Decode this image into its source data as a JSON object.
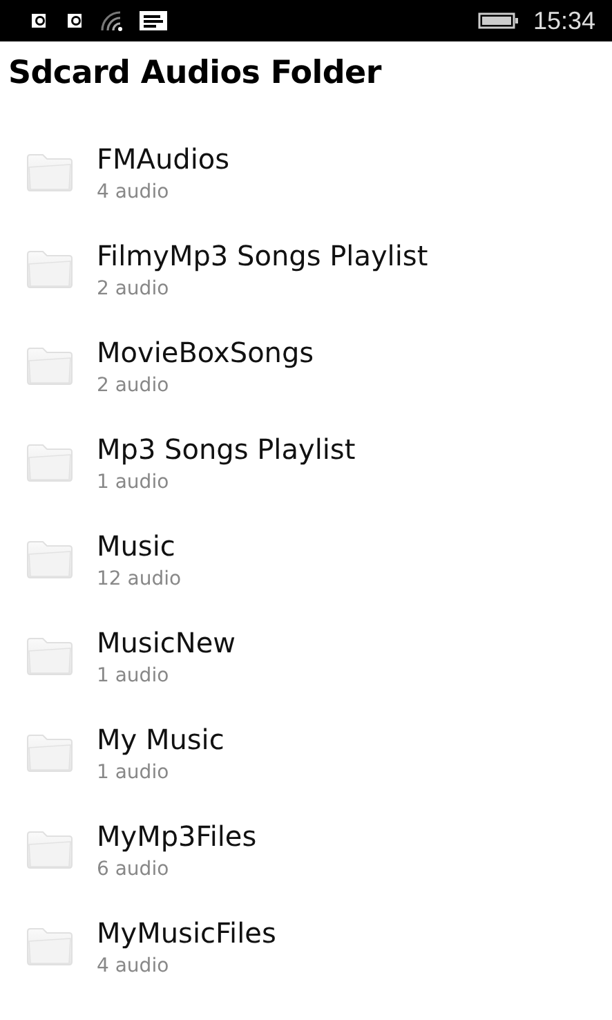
{
  "status_bar": {
    "time": "15:34"
  },
  "title": "Sdcard Audios Folder",
  "folders": [
    {
      "name": "FMAudios",
      "count": "4 audio"
    },
    {
      "name": "FilmyMp3 Songs Playlist",
      "count": "2 audio"
    },
    {
      "name": "MovieBoxSongs",
      "count": "2 audio"
    },
    {
      "name": "Mp3 Songs Playlist",
      "count": "1 audio"
    },
    {
      "name": "Music",
      "count": "12 audio"
    },
    {
      "name": "MusicNew",
      "count": "1 audio"
    },
    {
      "name": "My Music",
      "count": "1 audio"
    },
    {
      "name": "MyMp3Files",
      "count": "6 audio"
    },
    {
      "name": "MyMusicFiles",
      "count": "4 audio"
    }
  ]
}
